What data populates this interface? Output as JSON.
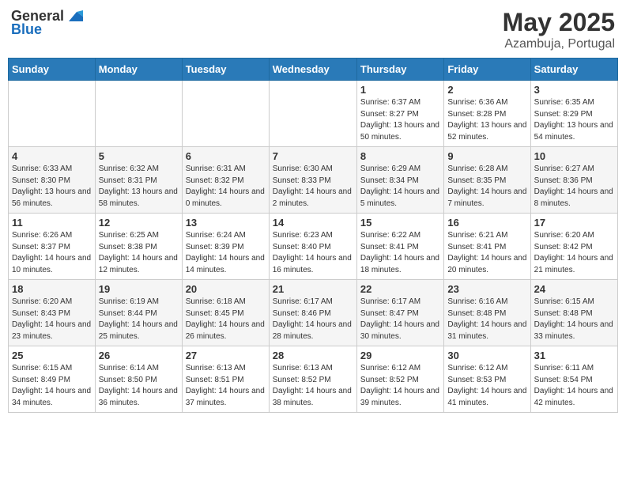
{
  "header": {
    "logo_general": "General",
    "logo_blue": "Blue",
    "month_year": "May 2025",
    "location": "Azambuja, Portugal"
  },
  "days_of_week": [
    "Sunday",
    "Monday",
    "Tuesday",
    "Wednesday",
    "Thursday",
    "Friday",
    "Saturday"
  ],
  "weeks": [
    [
      {
        "day": "",
        "sunrise": "",
        "sunset": "",
        "daylight": ""
      },
      {
        "day": "",
        "sunrise": "",
        "sunset": "",
        "daylight": ""
      },
      {
        "day": "",
        "sunrise": "",
        "sunset": "",
        "daylight": ""
      },
      {
        "day": "",
        "sunrise": "",
        "sunset": "",
        "daylight": ""
      },
      {
        "day": "1",
        "sunrise": "Sunrise: 6:37 AM",
        "sunset": "Sunset: 8:27 PM",
        "daylight": "Daylight: 13 hours and 50 minutes."
      },
      {
        "day": "2",
        "sunrise": "Sunrise: 6:36 AM",
        "sunset": "Sunset: 8:28 PM",
        "daylight": "Daylight: 13 hours and 52 minutes."
      },
      {
        "day": "3",
        "sunrise": "Sunrise: 6:35 AM",
        "sunset": "Sunset: 8:29 PM",
        "daylight": "Daylight: 13 hours and 54 minutes."
      }
    ],
    [
      {
        "day": "4",
        "sunrise": "Sunrise: 6:33 AM",
        "sunset": "Sunset: 8:30 PM",
        "daylight": "Daylight: 13 hours and 56 minutes."
      },
      {
        "day": "5",
        "sunrise": "Sunrise: 6:32 AM",
        "sunset": "Sunset: 8:31 PM",
        "daylight": "Daylight: 13 hours and 58 minutes."
      },
      {
        "day": "6",
        "sunrise": "Sunrise: 6:31 AM",
        "sunset": "Sunset: 8:32 PM",
        "daylight": "Daylight: 14 hours and 0 minutes."
      },
      {
        "day": "7",
        "sunrise": "Sunrise: 6:30 AM",
        "sunset": "Sunset: 8:33 PM",
        "daylight": "Daylight: 14 hours and 2 minutes."
      },
      {
        "day": "8",
        "sunrise": "Sunrise: 6:29 AM",
        "sunset": "Sunset: 8:34 PM",
        "daylight": "Daylight: 14 hours and 5 minutes."
      },
      {
        "day": "9",
        "sunrise": "Sunrise: 6:28 AM",
        "sunset": "Sunset: 8:35 PM",
        "daylight": "Daylight: 14 hours and 7 minutes."
      },
      {
        "day": "10",
        "sunrise": "Sunrise: 6:27 AM",
        "sunset": "Sunset: 8:36 PM",
        "daylight": "Daylight: 14 hours and 8 minutes."
      }
    ],
    [
      {
        "day": "11",
        "sunrise": "Sunrise: 6:26 AM",
        "sunset": "Sunset: 8:37 PM",
        "daylight": "Daylight: 14 hours and 10 minutes."
      },
      {
        "day": "12",
        "sunrise": "Sunrise: 6:25 AM",
        "sunset": "Sunset: 8:38 PM",
        "daylight": "Daylight: 14 hours and 12 minutes."
      },
      {
        "day": "13",
        "sunrise": "Sunrise: 6:24 AM",
        "sunset": "Sunset: 8:39 PM",
        "daylight": "Daylight: 14 hours and 14 minutes."
      },
      {
        "day": "14",
        "sunrise": "Sunrise: 6:23 AM",
        "sunset": "Sunset: 8:40 PM",
        "daylight": "Daylight: 14 hours and 16 minutes."
      },
      {
        "day": "15",
        "sunrise": "Sunrise: 6:22 AM",
        "sunset": "Sunset: 8:41 PM",
        "daylight": "Daylight: 14 hours and 18 minutes."
      },
      {
        "day": "16",
        "sunrise": "Sunrise: 6:21 AM",
        "sunset": "Sunset: 8:41 PM",
        "daylight": "Daylight: 14 hours and 20 minutes."
      },
      {
        "day": "17",
        "sunrise": "Sunrise: 6:20 AM",
        "sunset": "Sunset: 8:42 PM",
        "daylight": "Daylight: 14 hours and 21 minutes."
      }
    ],
    [
      {
        "day": "18",
        "sunrise": "Sunrise: 6:20 AM",
        "sunset": "Sunset: 8:43 PM",
        "daylight": "Daylight: 14 hours and 23 minutes."
      },
      {
        "day": "19",
        "sunrise": "Sunrise: 6:19 AM",
        "sunset": "Sunset: 8:44 PM",
        "daylight": "Daylight: 14 hours and 25 minutes."
      },
      {
        "day": "20",
        "sunrise": "Sunrise: 6:18 AM",
        "sunset": "Sunset: 8:45 PM",
        "daylight": "Daylight: 14 hours and 26 minutes."
      },
      {
        "day": "21",
        "sunrise": "Sunrise: 6:17 AM",
        "sunset": "Sunset: 8:46 PM",
        "daylight": "Daylight: 14 hours and 28 minutes."
      },
      {
        "day": "22",
        "sunrise": "Sunrise: 6:17 AM",
        "sunset": "Sunset: 8:47 PM",
        "daylight": "Daylight: 14 hours and 30 minutes."
      },
      {
        "day": "23",
        "sunrise": "Sunrise: 6:16 AM",
        "sunset": "Sunset: 8:48 PM",
        "daylight": "Daylight: 14 hours and 31 minutes."
      },
      {
        "day": "24",
        "sunrise": "Sunrise: 6:15 AM",
        "sunset": "Sunset: 8:48 PM",
        "daylight": "Daylight: 14 hours and 33 minutes."
      }
    ],
    [
      {
        "day": "25",
        "sunrise": "Sunrise: 6:15 AM",
        "sunset": "Sunset: 8:49 PM",
        "daylight": "Daylight: 14 hours and 34 minutes."
      },
      {
        "day": "26",
        "sunrise": "Sunrise: 6:14 AM",
        "sunset": "Sunset: 8:50 PM",
        "daylight": "Daylight: 14 hours and 36 minutes."
      },
      {
        "day": "27",
        "sunrise": "Sunrise: 6:13 AM",
        "sunset": "Sunset: 8:51 PM",
        "daylight": "Daylight: 14 hours and 37 minutes."
      },
      {
        "day": "28",
        "sunrise": "Sunrise: 6:13 AM",
        "sunset": "Sunset: 8:52 PM",
        "daylight": "Daylight: 14 hours and 38 minutes."
      },
      {
        "day": "29",
        "sunrise": "Sunrise: 6:12 AM",
        "sunset": "Sunset: 8:52 PM",
        "daylight": "Daylight: 14 hours and 39 minutes."
      },
      {
        "day": "30",
        "sunrise": "Sunrise: 6:12 AM",
        "sunset": "Sunset: 8:53 PM",
        "daylight": "Daylight: 14 hours and 41 minutes."
      },
      {
        "day": "31",
        "sunrise": "Sunrise: 6:11 AM",
        "sunset": "Sunset: 8:54 PM",
        "daylight": "Daylight: 14 hours and 42 minutes."
      }
    ]
  ]
}
